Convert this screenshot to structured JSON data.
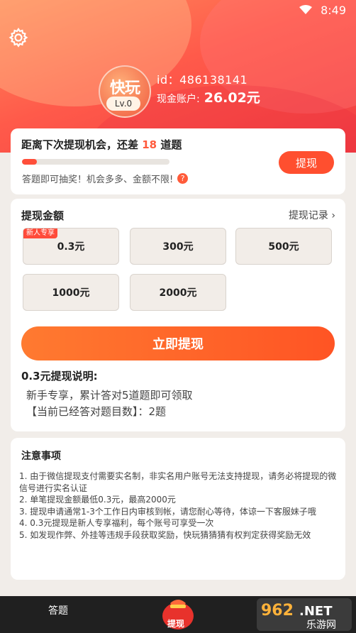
{
  "status_bar": {
    "time": "8:49",
    "wifi_icon": "wifi-icon",
    "battery_icon": "battery-icon"
  },
  "header": {
    "avatar_text": "快玩",
    "level": "Lv.0",
    "user_id": "id：486138141",
    "cash_label": "现金账户:",
    "cash_amount": "26.02元"
  },
  "chance_card": {
    "title_prefix": "距离下次提现机会，还差",
    "remaining": "18",
    "title_suffix": "道题",
    "progress": 0.1,
    "note": "答题即可抽奖！机会多多、金额不限!",
    "button": "提现"
  },
  "withdraw_card": {
    "title": "提现金额",
    "record_link": "提现记录",
    "options": [
      {
        "label": "0.3元",
        "tag": "新人专享"
      },
      {
        "label": "300元"
      },
      {
        "label": "500元"
      },
      {
        "label": "1000元"
      },
      {
        "label": "2000元"
      }
    ],
    "submit_button": "立即提现",
    "explain_title": "0.3元提现说明:",
    "explain_line1": "新手专享，累计答对5道题即可领取",
    "explain_line2": "【当前已经答对题目数】：2题"
  },
  "notice_card": {
    "title": "注意事项",
    "items": [
      "1. 由于微信提现支付需要实名制，非实名用户账号无法支持提现，请务必将提现的微信号进行实名认证",
      "2. 单笔提现金额最低0.3元，最高2000元",
      "3. 提现申请通常1-3个工作日内审核到帐，请您耐心等待，体谅一下客服妹子哦",
      "4. 0.3元提现是新人专享福利，每个账号可享受一次",
      "5. 如发现作弊、外挂等违规手段获取奖励，快玩猜猜猜有权判定获得奖励无效"
    ]
  },
  "tabbar": {
    "tab_answer": "答题",
    "tab_withdraw": "提现"
  },
  "watermark": {
    "top": "962",
    "suffix": ".NET",
    "bottom": "乐游网"
  },
  "colors": {
    "accent": "#ff5424",
    "header": "#f04a44",
    "tabbar": "#202020"
  }
}
